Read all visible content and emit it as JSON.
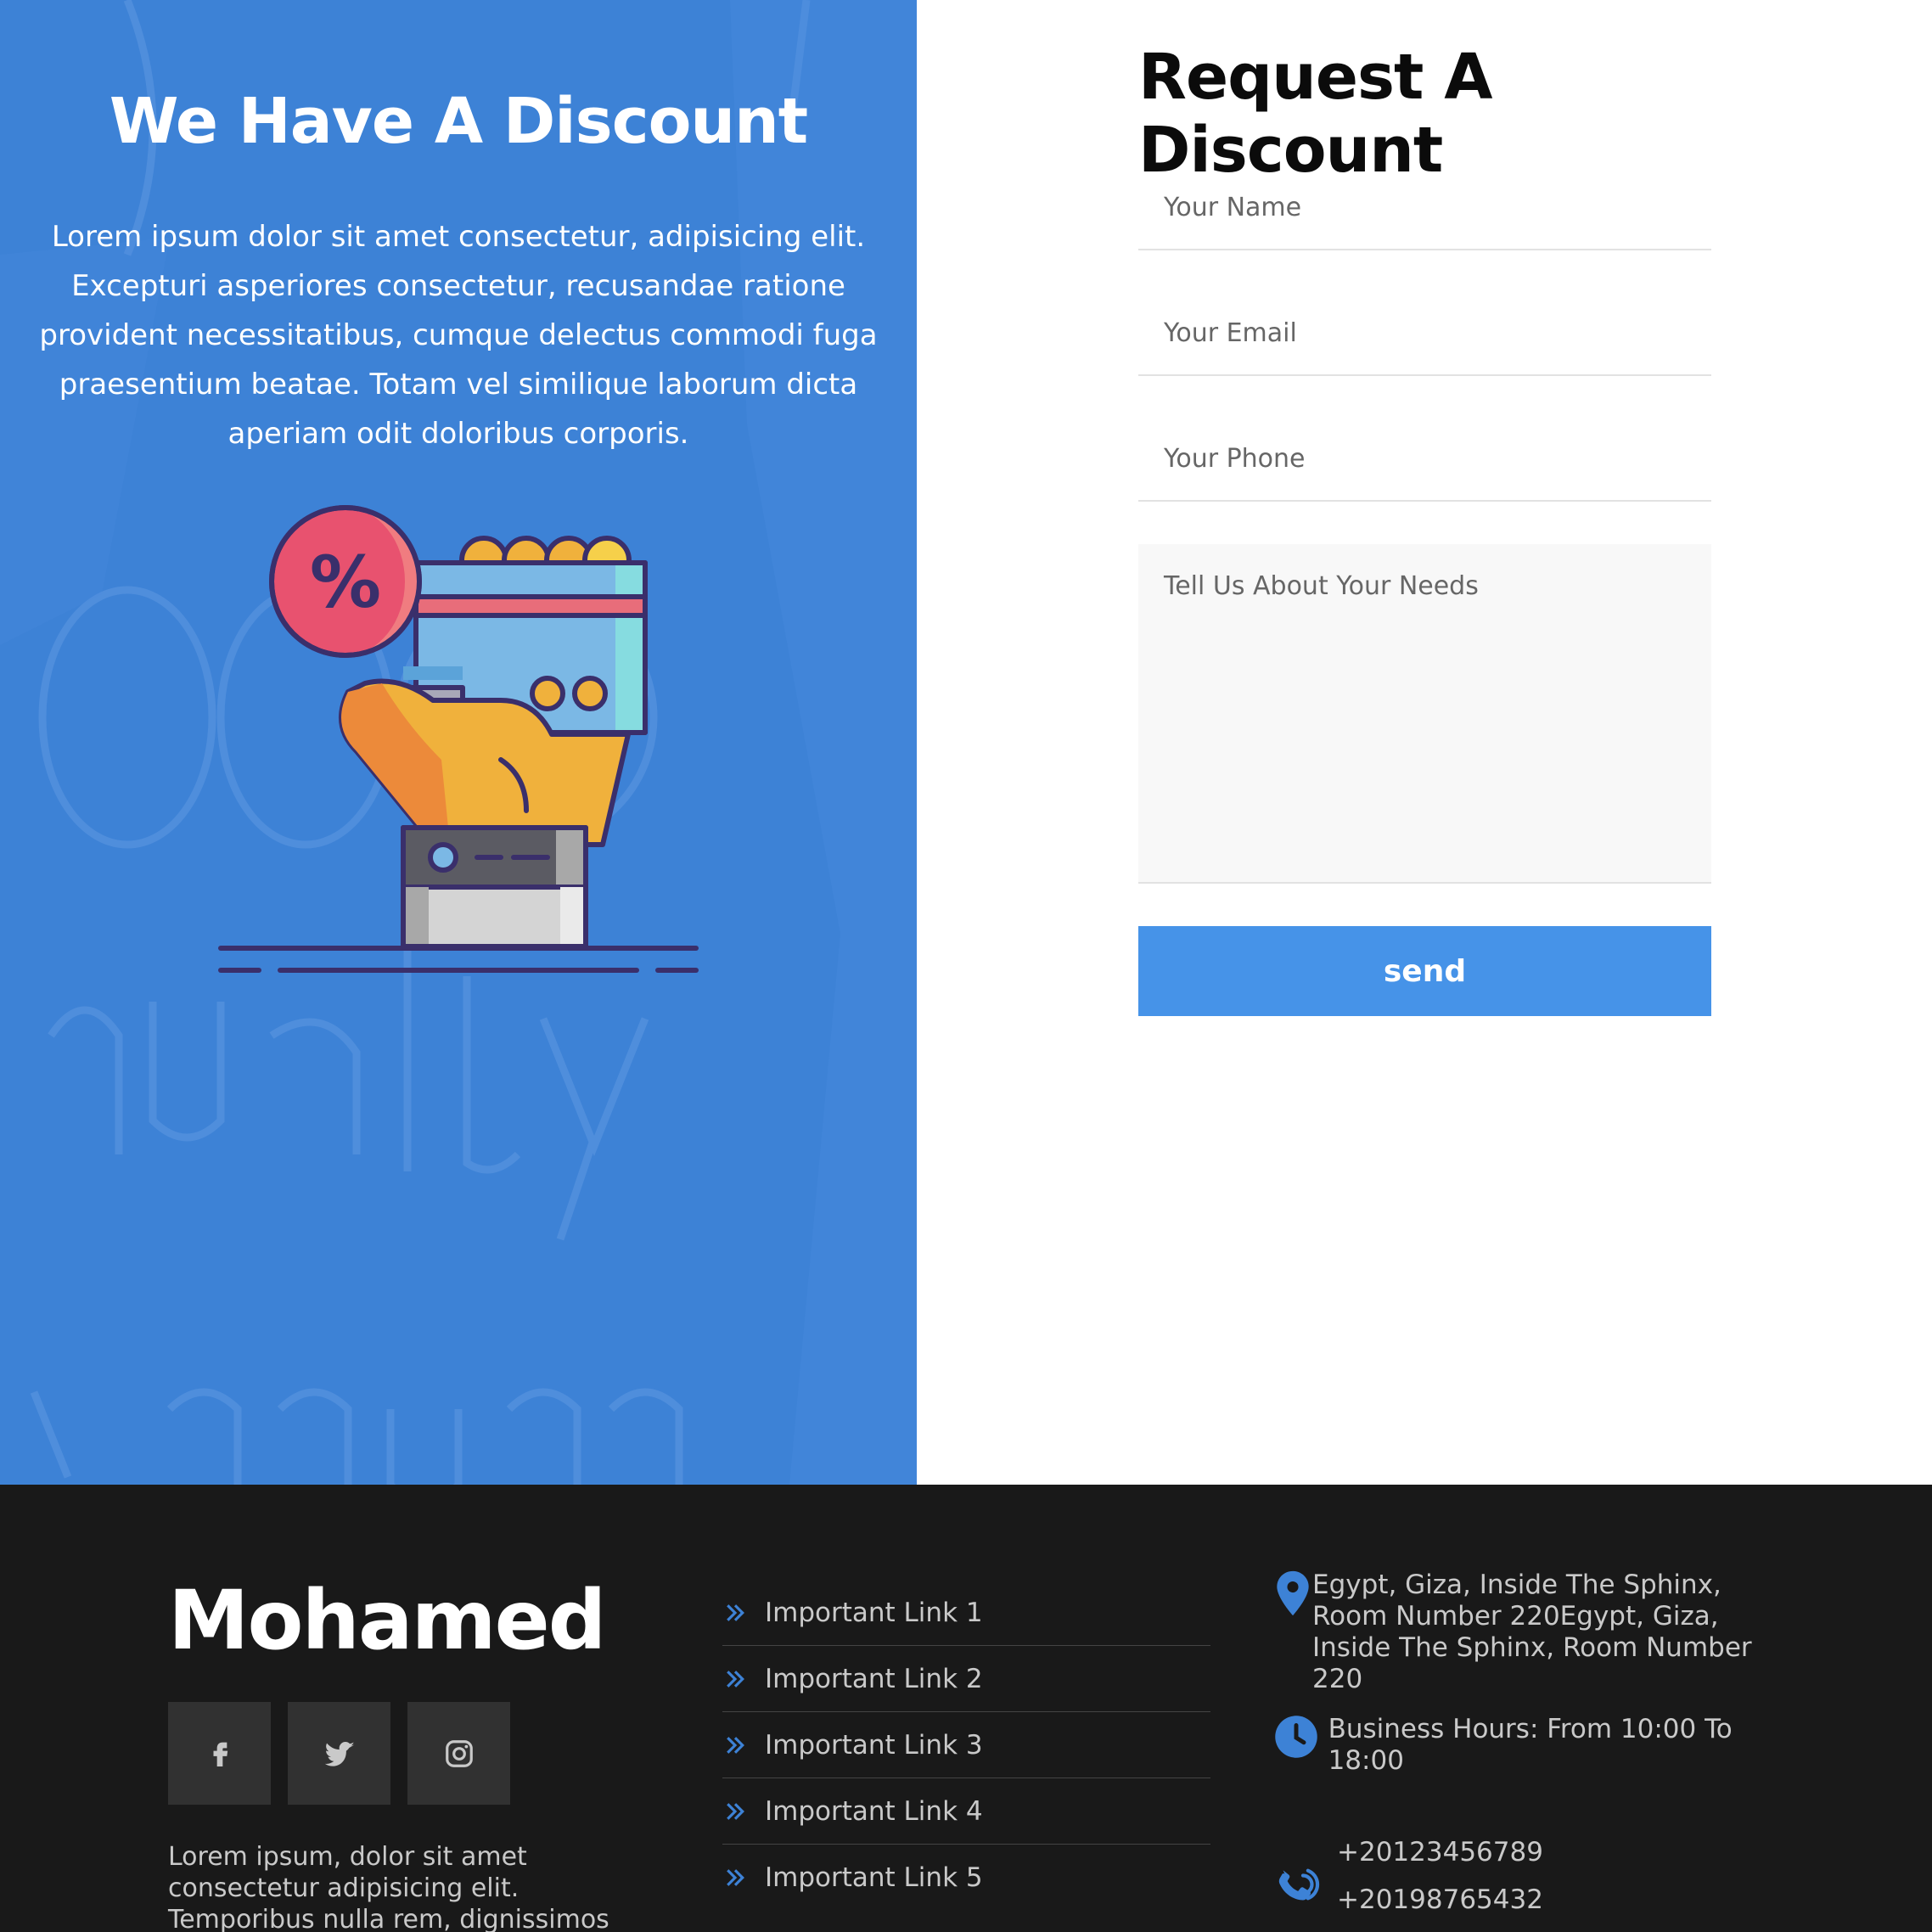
{
  "promo": {
    "title": "We Have A Discount",
    "text": "Lorem ipsum dolor sit amet consectetur, adipisicing elit. Excepturi asperiores consectetur, recusandae ratione provident necessitatibus, cumque delectus commodi fuga praesentium beatae. Totam vel similique laborum dicta aperiam odit doloribus corporis.",
    "illustration_icon": "hand-holding-discount-card-icon",
    "background_color": "#3d82d6"
  },
  "form": {
    "title": "Request A Discount",
    "name_placeholder": "Your Name",
    "email_placeholder": "Your Email",
    "phone_placeholder": "Your Phone",
    "needs_placeholder": "Tell Us About Your Needs",
    "send_label": "send",
    "button_color": "#4693e8"
  },
  "footer": {
    "brand": "Mohamed",
    "socials": [
      {
        "icon": "facebook-icon"
      },
      {
        "icon": "twitter-icon"
      },
      {
        "icon": "instagram-icon"
      }
    ],
    "about": "Lorem ipsum, dolor sit amet consectetur adipisicing elit. Temporibus nulla rem, dignissimos iste aspernatur",
    "links": [
      "Important Link 1",
      "Important Link 2",
      "Important Link 3",
      "Important Link 4",
      "Important Link 5"
    ],
    "address": "Egypt, Giza, Inside The Sphinx, Room Number 220Egypt, Giza, Inside The Sphinx, Room Number 220",
    "hours": "Business Hours: From 10:00 To 18:00",
    "phones": [
      "+20123456789",
      "+20198765432"
    ],
    "accent_color": "#3d82d6",
    "background_color": "#191919"
  }
}
